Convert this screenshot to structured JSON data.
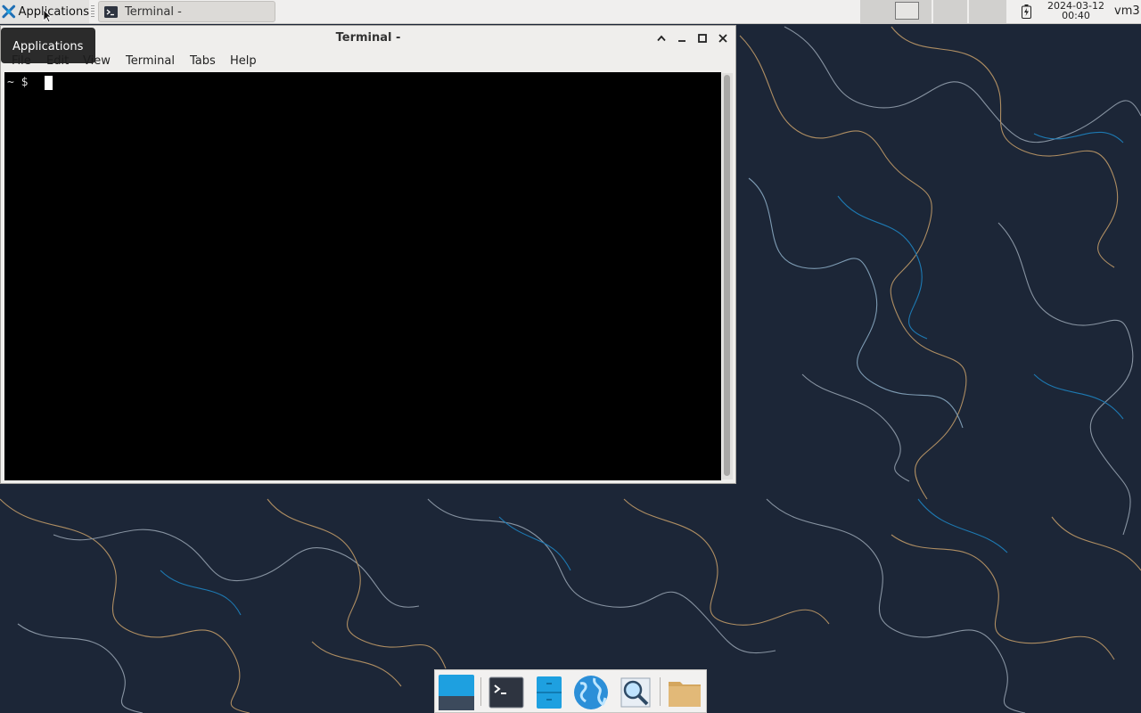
{
  "panel": {
    "applications_label": "Applications",
    "task_label": "Terminal -",
    "clock_date": "2024-03-12",
    "clock_time": "00:40",
    "user": "vm3"
  },
  "tooltip": {
    "text": "Applications"
  },
  "window": {
    "title": "Terminal -",
    "menu": [
      "File",
      "Edit",
      "View",
      "Terminal",
      "Tabs",
      "Help"
    ],
    "prompt": "~ $"
  },
  "dock": {
    "items": [
      "desktop-icon",
      "terminal-icon",
      "file-cabinet-icon",
      "web-browser-icon",
      "app-finder-icon",
      "folder-icon"
    ]
  },
  "colors": {
    "accent": "#1ea0e0",
    "wallpaper": "#1c2637",
    "terminal_bg": "#000000"
  }
}
